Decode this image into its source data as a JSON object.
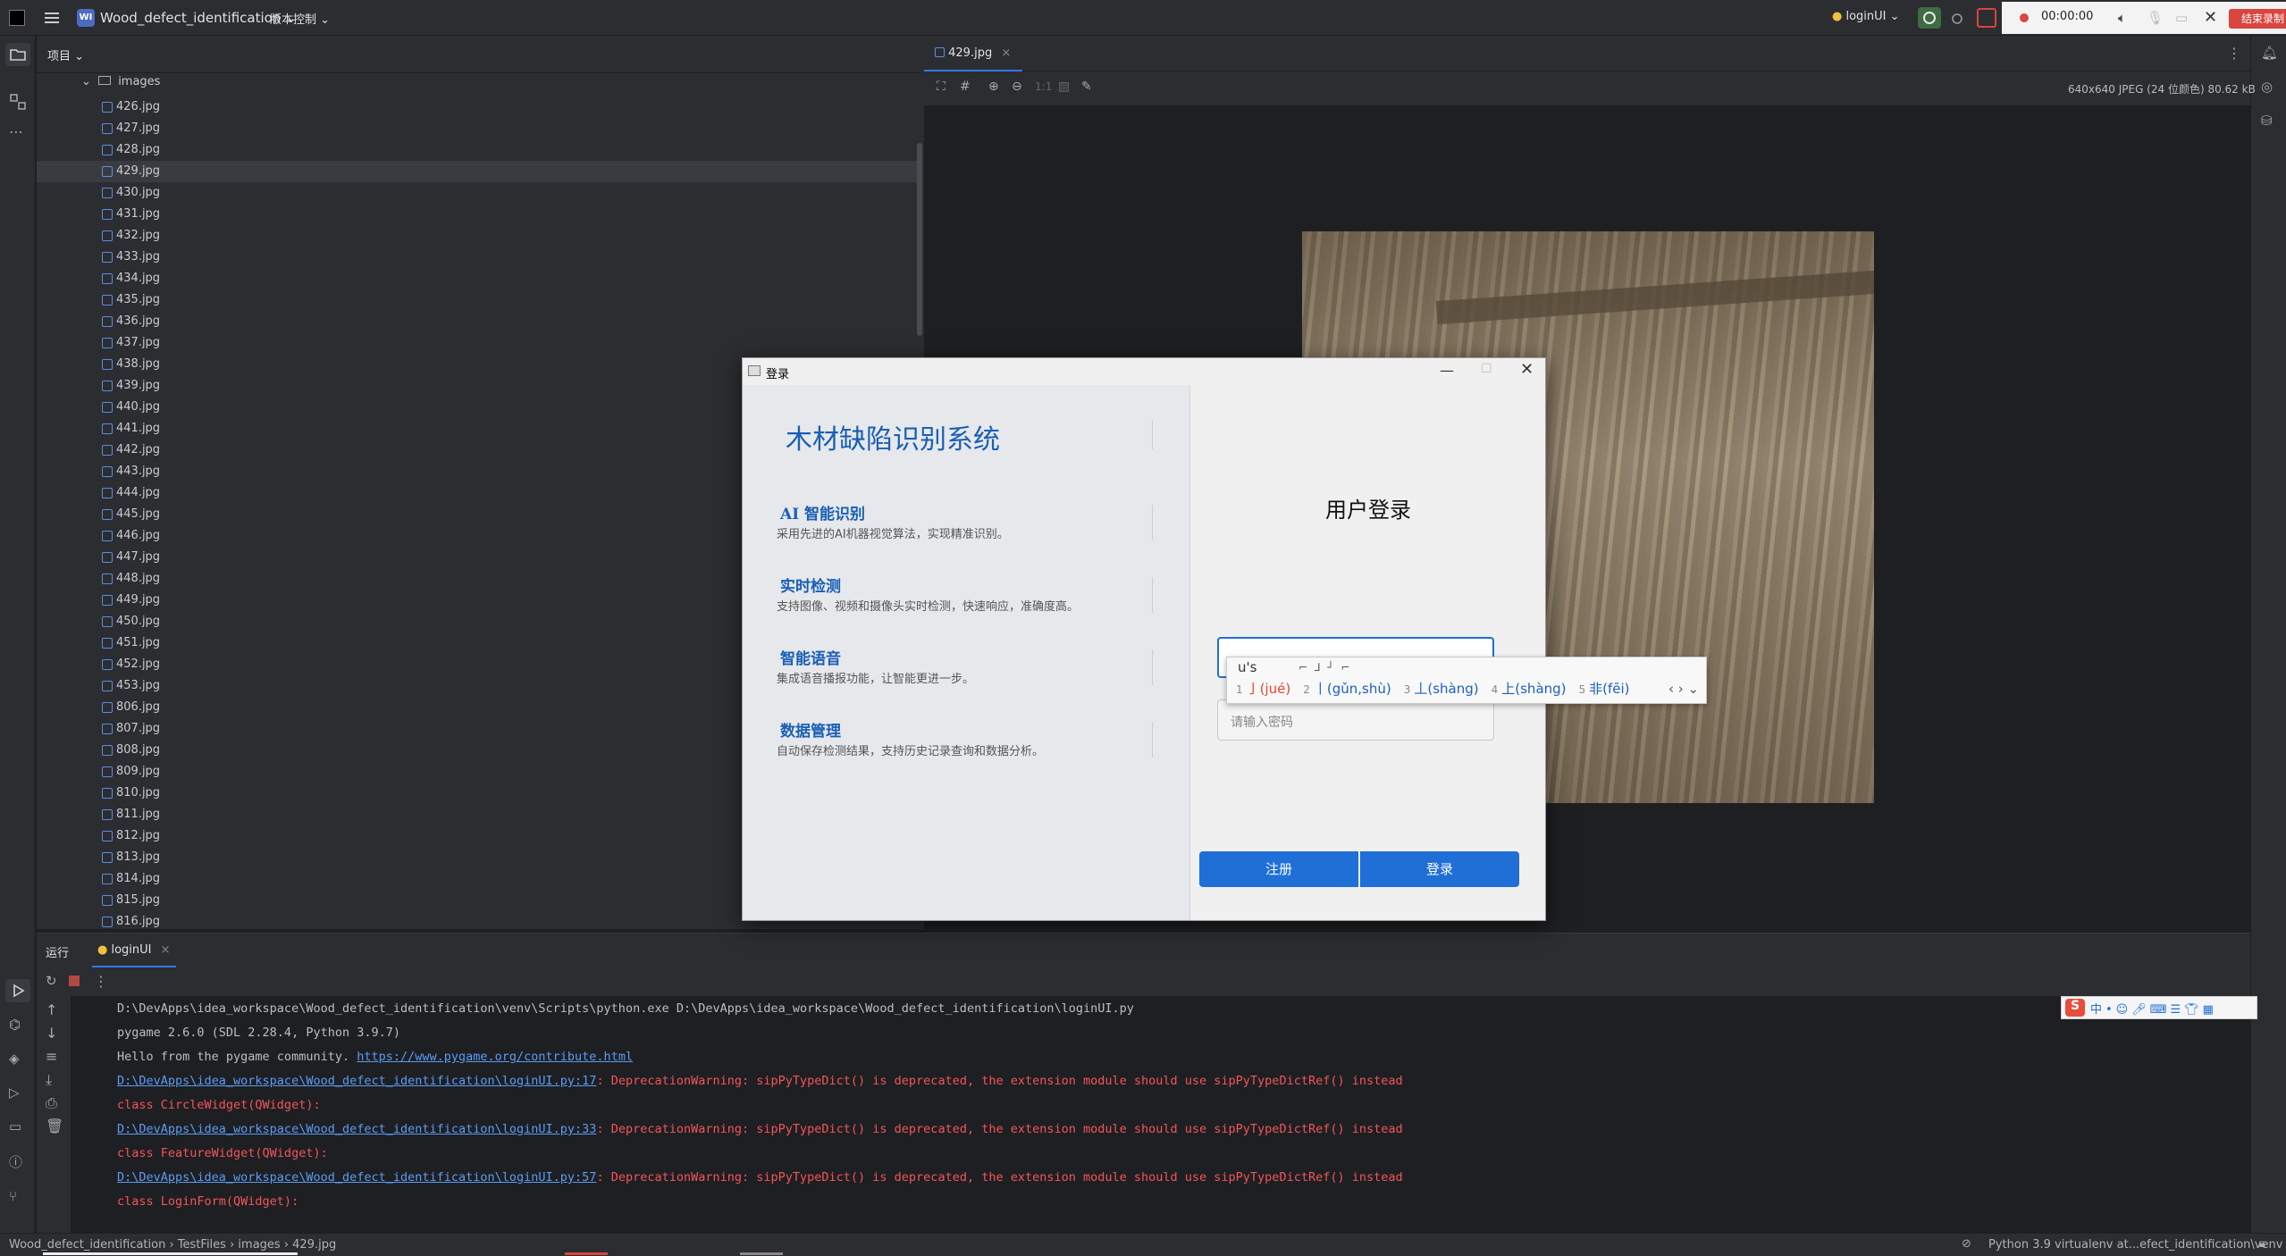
{
  "titlebar": {
    "project_badge": "WI",
    "project_name": "Wood_defect_identification",
    "vcs_label": "版本控制",
    "run_config": "loginUI",
    "recording_time": "00:00:00",
    "end_recording": "结束录制"
  },
  "project_panel": {
    "title": "项目",
    "folder": "images",
    "files": [
      "426.jpg",
      "427.jpg",
      "428.jpg",
      "429.jpg",
      "430.jpg",
      "431.jpg",
      "432.jpg",
      "433.jpg",
      "434.jpg",
      "435.jpg",
      "436.jpg",
      "437.jpg",
      "438.jpg",
      "439.jpg",
      "440.jpg",
      "441.jpg",
      "442.jpg",
      "443.jpg",
      "444.jpg",
      "445.jpg",
      "446.jpg",
      "447.jpg",
      "448.jpg",
      "449.jpg",
      "450.jpg",
      "451.jpg",
      "452.jpg",
      "453.jpg",
      "806.jpg",
      "807.jpg",
      "808.jpg",
      "809.jpg",
      "810.jpg",
      "811.jpg",
      "812.jpg",
      "813.jpg",
      "814.jpg",
      "815.jpg",
      "816.jpg"
    ],
    "selected": "429.jpg"
  },
  "editor": {
    "tab": "429.jpg",
    "zoom_label": "1:1",
    "image_info": "640x640 JPEG (24 位颜色) 80.62 kB"
  },
  "dialog": {
    "window_title": "登录",
    "app_title": "木材缺陷识别系统",
    "features": [
      {
        "title": "AI 智能识别",
        "desc": "采用先进的AI机器视觉算法，实现精准识别。"
      },
      {
        "title": "实时检测",
        "desc": "支持图像、视频和摄像头实时检测，快速响应，准确度高。"
      },
      {
        "title": "智能语音",
        "desc": "集成语音播报功能，让智能更进一步。"
      },
      {
        "title": "数据管理",
        "desc": "自动保存检测结果，支持历史记录查询和数据分析。"
      }
    ],
    "login_title": "用户登录",
    "username_input": "u's",
    "password_placeholder": "请输入密码",
    "register_button": "注册",
    "login_button": "登录"
  },
  "ime": {
    "composition": "u's",
    "candidates": [
      {
        "idx": "1",
        "text": "亅(jué)"
      },
      {
        "idx": "2",
        "text": "丨(gǔn,shù)"
      },
      {
        "idx": "3",
        "text": "丄(shàng)"
      },
      {
        "idx": "4",
        "text": "上(shàng)"
      },
      {
        "idx": "5",
        "text": "非(fēi)"
      }
    ]
  },
  "run_panel": {
    "label": "运行",
    "tab": "loginUI",
    "console": [
      {
        "segments": [
          {
            "cls": "c-norm",
            "text": "D:\\DevApps\\idea_workspace\\Wood_defect_identification\\venv\\Scripts\\python.exe D:\\DevApps\\idea_workspace\\Wood_defect_identification\\loginUI.py"
          }
        ]
      },
      {
        "segments": [
          {
            "cls": "c-norm",
            "text": "pygame 2.6.0 (SDL 2.28.4, Python 3.9.7)"
          }
        ]
      },
      {
        "segments": [
          {
            "cls": "c-norm",
            "text": "Hello from the pygame community. "
          },
          {
            "cls": "c-link",
            "text": "https://www.pygame.org/contribute.html"
          }
        ]
      },
      {
        "segments": [
          {
            "cls": "c-link",
            "text": "D:\\DevApps\\idea_workspace\\Wood_defect_identification\\loginUI.py:17"
          },
          {
            "cls": "c-err",
            "text": ": DeprecationWarning: sipPyTypeDict() is deprecated, the extension module should use sipPyTypeDictRef() instead"
          }
        ]
      },
      {
        "segments": [
          {
            "cls": "c-err",
            "text": "  class CircleWidget(QWidget):"
          }
        ]
      },
      {
        "segments": [
          {
            "cls": "c-link",
            "text": "D:\\DevApps\\idea_workspace\\Wood_defect_identification\\loginUI.py:33"
          },
          {
            "cls": "c-err",
            "text": ": DeprecationWarning: sipPyTypeDict() is deprecated, the extension module should use sipPyTypeDictRef() instead"
          }
        ]
      },
      {
        "segments": [
          {
            "cls": "c-err",
            "text": "  class FeatureWidget(QWidget):"
          }
        ]
      },
      {
        "segments": [
          {
            "cls": "c-link",
            "text": "D:\\DevApps\\idea_workspace\\Wood_defect_identification\\loginUI.py:57"
          },
          {
            "cls": "c-err",
            "text": ": DeprecationWarning: sipPyTypeDict() is deprecated, the extension module should use sipPyTypeDictRef() instead"
          }
        ]
      },
      {
        "segments": [
          {
            "cls": "c-err",
            "text": "  class LoginForm(QWidget):"
          }
        ]
      }
    ]
  },
  "statusbar": {
    "breadcrumbs": [
      "Wood_defect_identification",
      "TestFiles",
      "images",
      "429.jpg"
    ],
    "interpreter": "Python 3.9 virtualenv at...efect_identification\\venv"
  },
  "colors": {
    "accent": "#1f6fd6",
    "title_blue": "#1a5fb4",
    "record_red": "#d9453f"
  }
}
